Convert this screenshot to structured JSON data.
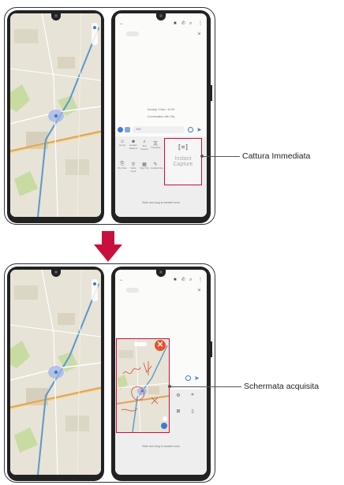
{
  "callouts": {
    "instant_capture": "Cattura Immediata",
    "captured_screen": "Schermata acquisita"
  },
  "messenger": {
    "date_stamp": "Sunday, 3 Mar • 10:30",
    "conversation_label": "Conversation with Olly",
    "input_placeholder": "Text",
    "footer_hint": "Slide and drag to transfer tools"
  },
  "instant_capture_tile": {
    "glyph": "[⌗]",
    "label_line1": "Instant",
    "label_line2": "Capture"
  },
  "toolbar_top_tiles": [
    {
      "icon": "smiley-icon",
      "glyph": "☺",
      "label": "Emoji"
    },
    {
      "icon": "sticker-icon",
      "glyph": "☻",
      "label": "Handw. Stickers"
    },
    {
      "icon": "search-icon",
      "glyph": "⌕",
      "label": "Text Search"
    },
    {
      "icon": "translate-icon",
      "glyph": "文",
      "label": "Translate"
    }
  ],
  "toolbar_bottom_tiles": [
    {
      "icon": "clip-icon",
      "glyph": "⎘",
      "label": "My Files"
    },
    {
      "icon": "location-icon",
      "glyph": "⚲",
      "label": "Voice Input"
    },
    {
      "icon": "calendar-icon",
      "glyph": "▦",
      "label": "Day Trip"
    },
    {
      "icon": "pen-icon",
      "glyph": "✎",
      "label": "Handwriting"
    }
  ],
  "colors": {
    "arrow": "#c8103e",
    "capture_frame": "#c8103e",
    "close_button": "#e8502a",
    "ink": "#d04a2a",
    "accent_blue": "#3b7bd4"
  }
}
